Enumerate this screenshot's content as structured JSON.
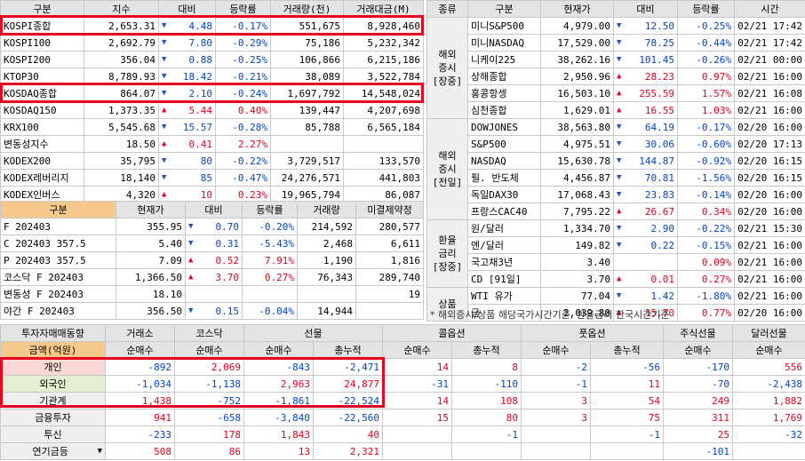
{
  "index_table": {
    "headers": [
      "구분",
      "지수",
      "대비",
      "등락률",
      "거래량(천)",
      "거래대금(M)"
    ],
    "rows": [
      {
        "name": "KOSPI종합",
        "value": "2,653.31",
        "dir": "dn",
        "change": "4.48",
        "rate": "-0.17%",
        "volume": "551,675",
        "amount": "8,928,460"
      },
      {
        "name": "KOSPI100",
        "value": "2,692.79",
        "dir": "dn",
        "change": "7.80",
        "rate": "-0.29%",
        "volume": "75,186",
        "amount": "5,232,342"
      },
      {
        "name": "KOSPI200",
        "value": "356.04",
        "dir": "dn",
        "change": "0.88",
        "rate": "-0.25%",
        "volume": "106,866",
        "amount": "6,215,186"
      },
      {
        "name": "KTOP30",
        "value": "8,789.93",
        "dir": "dn",
        "change": "18.42",
        "rate": "-0.21%",
        "volume": "38,089",
        "amount": "3,522,784"
      },
      {
        "name": "KOSDAQ종합",
        "value": "864.07",
        "dir": "dn",
        "change": "2.10",
        "rate": "-0.24%",
        "volume": "1,697,792",
        "amount": "14,548,024"
      },
      {
        "name": "KOSDAQ150",
        "value": "1,373.35",
        "dir": "up",
        "change": "5.44",
        "rate": "0.40%",
        "volume": "139,447",
        "amount": "4,207,698"
      },
      {
        "name": "KRX100",
        "value": "5,545.68",
        "dir": "dn",
        "change": "15.57",
        "rate": "-0.28%",
        "volume": "85,788",
        "amount": "6,565,184"
      },
      {
        "name": "변동성지수",
        "value": "18.50",
        "dir": "up",
        "change": "0.41",
        "rate": "2.27%",
        "volume": "",
        "amount": ""
      },
      {
        "name": "KODEX200",
        "value": "35,795",
        "dir": "dn",
        "change": "80",
        "rate": "-0.22%",
        "volume": "3,729,517",
        "amount": "133,570"
      },
      {
        "name": "KODEX레버리지",
        "value": "18,140",
        "dir": "dn",
        "change": "85",
        "rate": "-0.47%",
        "volume": "24,276,571",
        "amount": "441,803"
      },
      {
        "name": "KODEX인버스",
        "value": "4,320",
        "dir": "up",
        "change": "10",
        "rate": "0.23%",
        "volume": "19,965,794",
        "amount": "86,087"
      }
    ]
  },
  "futures_table": {
    "headers": [
      "구분",
      "현재가",
      "대비",
      "등락률",
      "거래량",
      "미결제약정"
    ],
    "rows": [
      {
        "name": "F 202403",
        "value": "355.95",
        "dir": "dn",
        "change": "0.70",
        "rate": "-0.20%",
        "volume": "214,592",
        "oi": "280,577"
      },
      {
        "name": "C 202403 357.5",
        "value": "5.40",
        "dir": "dn",
        "change": "0.31",
        "rate": "-5.43%",
        "volume": "2,468",
        "oi": "6,611"
      },
      {
        "name": "P 202403 357.5",
        "value": "7.09",
        "dir": "up",
        "change": "0.52",
        "rate": "7.91%",
        "volume": "1,190",
        "oi": "1,816"
      },
      {
        "name": "코스닥 F 202403",
        "value": "1,366.50",
        "dir": "up",
        "change": "3.70",
        "rate": "0.27%",
        "volume": "76,343",
        "oi": "289,740"
      },
      {
        "name": "변동성 F 202403",
        "value": "18.10",
        "dir": "",
        "change": "",
        "rate": "",
        "volume": "",
        "oi": "19"
      },
      {
        "name": "야간  F 202403",
        "value": "356.50",
        "dir": "dn",
        "change": "0.15",
        "rate": "-0.04%",
        "volume": "14,944",
        "oi": ""
      }
    ]
  },
  "global_table": {
    "headers": [
      "종류",
      "구분",
      "현재가",
      "대비",
      "등락률",
      "시간"
    ],
    "groups": [
      {
        "label": "해외\n증시\n[장중]",
        "rows": [
          {
            "name": "미니S&P500",
            "value": "4,979.00",
            "dir": "dn",
            "change": "12.50",
            "rate": "-0.25%",
            "time": "02/21 17:42"
          },
          {
            "name": "미니NASDAQ",
            "value": "17,529.00",
            "dir": "dn",
            "change": "78.25",
            "rate": "-0.44%",
            "time": "02/21 17:42"
          },
          {
            "name": "니케이225",
            "value": "38,262.16",
            "dir": "dn",
            "change": "101.45",
            "rate": "-0.26%",
            "time": "02/21 00:00"
          },
          {
            "name": "상해종합",
            "value": "2,950.96",
            "dir": "up",
            "change": "28.23",
            "rate": "0.97%",
            "time": "02/21 16:00"
          },
          {
            "name": "홍콩항셍",
            "value": "16,503.10",
            "dir": "up",
            "change": "255.59",
            "rate": "1.57%",
            "time": "02/21 16:08"
          },
          {
            "name": "심천종합",
            "value": "1,629.01",
            "dir": "up",
            "change": "16.55",
            "rate": "1.03%",
            "time": "02/21 16:00"
          }
        ]
      },
      {
        "label": "해외\n증시\n[전일]",
        "rows": [
          {
            "name": "DOWJONES",
            "value": "38,563.80",
            "dir": "dn",
            "change": "64.19",
            "rate": "-0.17%",
            "time": "02/20 16:00"
          },
          {
            "name": "S&P500",
            "value": "4,975.51",
            "dir": "dn",
            "change": "30.06",
            "rate": "-0.60%",
            "time": "02/20 17:13"
          },
          {
            "name": "NASDAQ",
            "value": "15,630.78",
            "dir": "dn",
            "change": "144.87",
            "rate": "-0.92%",
            "time": "02/20 16:15"
          },
          {
            "name": "필. 반도체",
            "value": "4,456.87",
            "dir": "dn",
            "change": "70.81",
            "rate": "-1.56%",
            "time": "02/20 16:15"
          },
          {
            "name": "독일DAX30",
            "value": "17,068.43",
            "dir": "dn",
            "change": "23.83",
            "rate": "-0.14%",
            "time": "02/20 16:00"
          },
          {
            "name": "프랑스CAC40",
            "value": "7,795.22",
            "dir": "up",
            "change": "26.67",
            "rate": "0.34%",
            "time": "02/20 16:00"
          }
        ]
      },
      {
        "label": "환율\n금리\n[장중]",
        "rows": [
          {
            "name": "원/달러",
            "value": "1,334.70",
            "dir": "dn",
            "change": "2.90",
            "rate": "-0.22%",
            "time": "02/21 15:30"
          },
          {
            "name": "엔/달러",
            "value": "149.82",
            "dir": "dn",
            "change": "0.22",
            "rate": "-0.15%",
            "time": "02/21 16:00"
          },
          {
            "name": "국고채3년",
            "value": "3.40",
            "dir": "",
            "change": "",
            "rate": "0.09%",
            "time": "02/21 16:00"
          },
          {
            "name": "CD [91일]",
            "value": "3.70",
            "dir": "up",
            "change": "0.01",
            "rate": "0.27%",
            "time": "02/21 16:00"
          }
        ]
      },
      {
        "label": "상품",
        "rows": [
          {
            "name": "WTI 유가",
            "value": "77.04",
            "dir": "dn",
            "change": "1.42",
            "rate": "-1.80%",
            "time": "02/21 16:00"
          },
          {
            "name": "금",
            "value": "2,039.80",
            "dir": "up",
            "change": "15.70",
            "rate": "0.77%",
            "time": "02/20 16:00"
          }
        ]
      }
    ],
    "note": "* 해외증시/상품 해당국가시간기준, 환율금리 한국시간기준"
  },
  "investor_table": {
    "top_headers": [
      "투자자매매동향",
      "거래소",
      "코스닥",
      "선물",
      "콜옵션",
      "풋옵션",
      "주식선물",
      "달러선물"
    ],
    "sub_headers": [
      "금액(억원)",
      "순매수",
      "순매수",
      "순매수",
      "총누적",
      "순매수",
      "총누적",
      "순매수",
      "총누적",
      "순매수",
      "순매수"
    ],
    "rows": [
      {
        "name": "개인",
        "style": "pink",
        "values": [
          "-892",
          "2,069",
          "-843",
          "-2,471",
          "14",
          "8",
          "-2",
          "-56",
          "-170",
          "556"
        ]
      },
      {
        "name": "외국인",
        "style": "green",
        "values": [
          "-1,034",
          "-1,138",
          "2,963",
          "24,877",
          "-31",
          "-110",
          "-1",
          "11",
          "-70",
          "-2,438"
        ]
      },
      {
        "name": "기관계",
        "style": "plain",
        "values": [
          "1,438",
          "-752",
          "-1,861",
          "-22,524",
          "14",
          "108",
          "3",
          "54",
          "249",
          "1,882"
        ]
      },
      {
        "name": "금융투자",
        "style": "plain",
        "values": [
          "941",
          "-658",
          "-3,840",
          "-22,560",
          "15",
          "80",
          "3",
          "75",
          "311",
          "1,769"
        ]
      },
      {
        "name": "투신",
        "style": "plain",
        "values": [
          "-233",
          "178",
          "1,843",
          "40",
          "",
          "-1",
          "",
          "-1",
          "25",
          "-32"
        ]
      },
      {
        "name": "연기금등",
        "style": "plain",
        "values": [
          "508",
          "86",
          "13",
          "2,321",
          "",
          "",
          "",
          "",
          "-101",
          ""
        ]
      }
    ]
  },
  "colors": {
    "up": "#e8001c",
    "down": "#0044cc",
    "header": "#e4e4e4",
    "futures_header": "#f5c98a",
    "highlight": "#e8001c"
  },
  "icons": {
    "up": "triangle-up",
    "down": "triangle-down",
    "dropdown": "dropdown-arrow"
  }
}
